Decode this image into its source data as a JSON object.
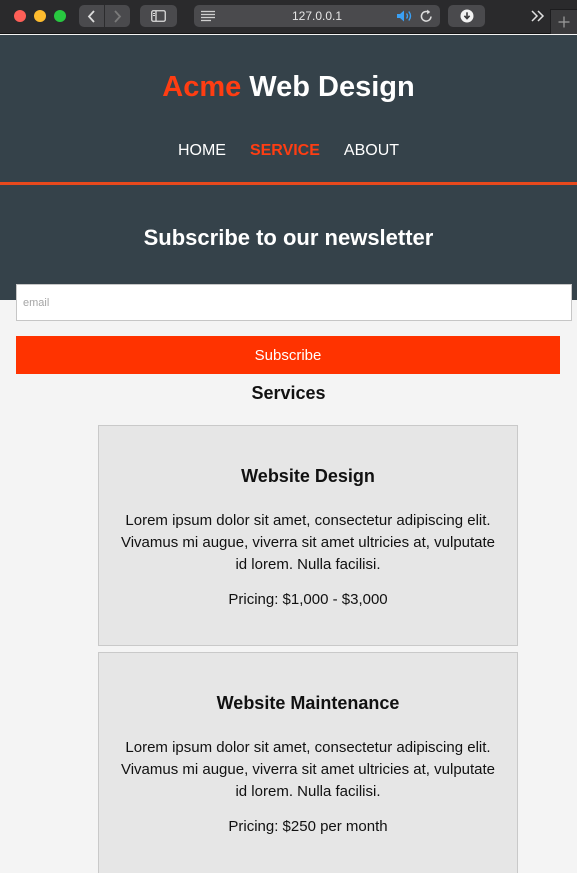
{
  "browser": {
    "url": "127.0.0.1",
    "icons": [
      "back-icon",
      "forward-icon",
      "sidebar-icon",
      "reader-icon",
      "speaker-icon",
      "reload-icon",
      "download-icon",
      "overflow-icon",
      "new-tab-icon"
    ]
  },
  "header": {
    "logo_highlight": "Acme",
    "logo_rest": " Web Design",
    "nav": [
      {
        "label": "HOME",
        "current": false
      },
      {
        "label": "SERVICE",
        "current": true
      },
      {
        "label": "ABOUT",
        "current": false
      }
    ]
  },
  "newsletter": {
    "title": "Subscribe to our newsletter",
    "email_placeholder": "email",
    "email_value": "",
    "button_label": "Subscribe"
  },
  "services": {
    "title": "Services",
    "items": [
      {
        "name": "Website Design",
        "description": "Lorem ipsum dolor sit amet, consectetur adipiscing elit. Vivamus mi augue, viverra sit amet ultricies at, vulputate id lorem. Nulla facilisi.",
        "pricing": "Pricing: $1,000 - $3,000"
      },
      {
        "name": "Website Maintenance",
        "description": "Lorem ipsum dolor sit amet, consectetur adipiscing elit. Vivamus mi augue, viverra sit amet ultricies at, vulputate id lorem. Nulla facilisi.",
        "pricing": "Pricing: $250 per month"
      }
    ]
  },
  "colors": {
    "header_bg": "#35424a",
    "accent": "#ff3d12",
    "button": "#ff3300",
    "card_bg": "#e6e6e6",
    "page_bg": "#f4f4f4"
  }
}
